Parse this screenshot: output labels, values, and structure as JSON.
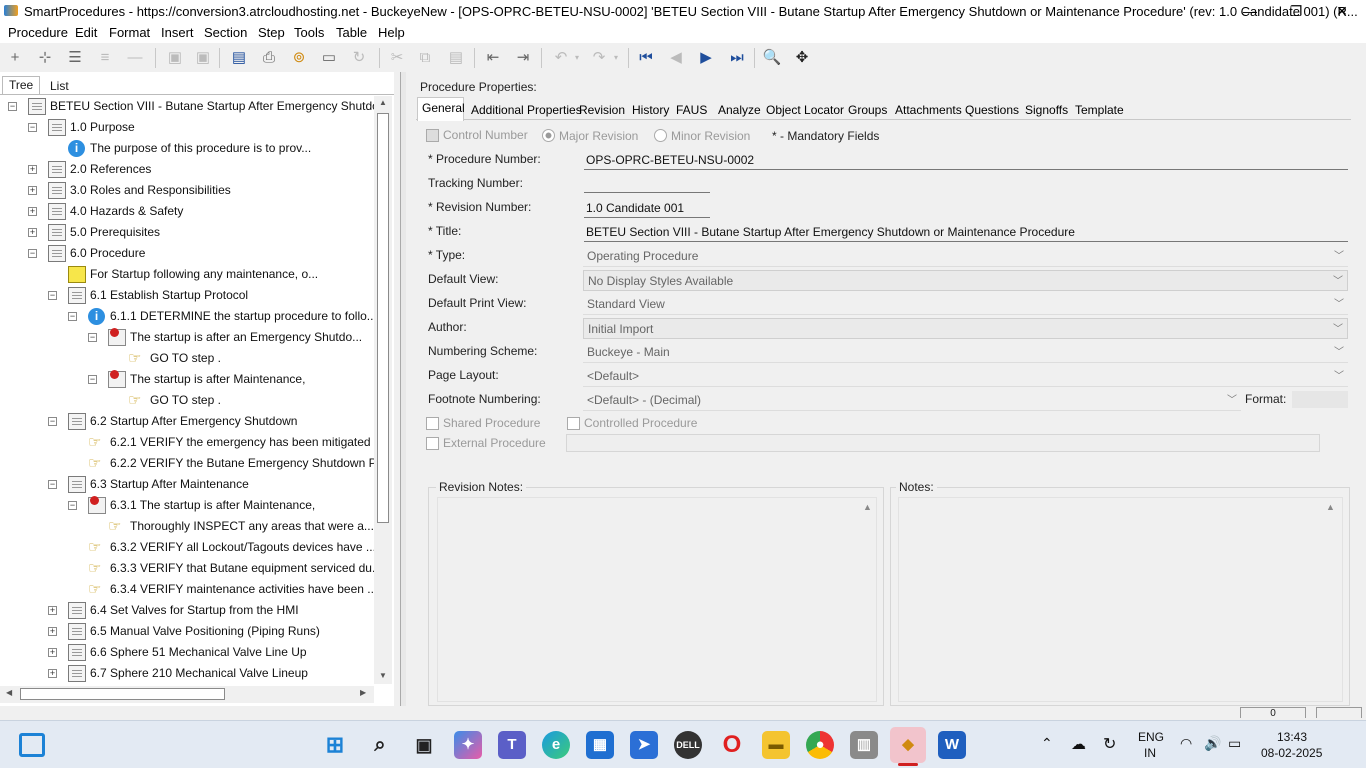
{
  "window": {
    "title": "SmartProcedures - https://conversion3.atrcloudhosting.net - BuckeyeNew - [OPS-OPRC-BETEU-NSU-0002] 'BETEU Section VIII - Butane Startup After Emergency Shutdown or Maintenance Procedure' (rev: 1.0 Candidate 001) (R...",
    "minimize": "—",
    "restore": "❐",
    "close": "✕"
  },
  "menu": [
    "Procedure",
    "Edit",
    "Format",
    "Insert",
    "Section",
    "Step",
    "Tools",
    "Table",
    "Help"
  ],
  "left_tabs": {
    "tree": "Tree",
    "list": "List"
  },
  "tree": [
    {
      "label": "BETEU Section VIII - Butane Startup After Emergency Shutdo...",
      "expander": "⊟",
      "icon": "doc-icon"
    },
    {
      "label": "1.0 Purpose",
      "expander": "⊟",
      "icon": "doc-icon"
    },
    {
      "label": "The purpose of this procedure is to prov...",
      "expander": "",
      "icon": "info-icon"
    },
    {
      "label": "2.0 References",
      "expander": "⊞",
      "icon": "doc-icon"
    },
    {
      "label": "3.0 Roles and Responsibilities",
      "expander": "⊞",
      "icon": "doc-icon"
    },
    {
      "label": "4.0 Hazards & Safety",
      "expander": "⊞",
      "icon": "doc-icon"
    },
    {
      "label": "5.0 Prerequisites",
      "expander": "⊞",
      "icon": "doc-icon"
    },
    {
      "label": "6.0 Procedure",
      "expander": "⊟",
      "icon": "doc-icon"
    },
    {
      "label": "For Startup following any maintenance, o...",
      "expander": "",
      "icon": "warning-icon"
    },
    {
      "label": "6.1 Establish Startup Protocol",
      "expander": "⊟",
      "icon": "doc-icon"
    },
    {
      "label": "6.1.1 DETERMINE the startup procedure to follo...",
      "expander": "⊟",
      "icon": "info-icon"
    },
    {
      "label": "The startup is after an Emergency Shutdo...",
      "expander": "⊟",
      "icon": "condition-icon"
    },
    {
      "label": "GO TO step .",
      "expander": "",
      "icon": "hand-icon"
    },
    {
      "label": "The startup is after Maintenance,",
      "expander": "⊟",
      "icon": "condition-icon"
    },
    {
      "label": "GO TO step .",
      "expander": "",
      "icon": "hand-icon"
    },
    {
      "label": "6.2 Startup After Emergency Shutdown",
      "expander": "⊟",
      "icon": "doc-icon"
    },
    {
      "label": "6.2.1 VERIFY the emergency has been mitigated ...",
      "expander": "",
      "icon": "hand-icon"
    },
    {
      "label": "6.2.2 VERIFY the Butane Emergency Shutdown Pr...",
      "expander": "",
      "icon": "hand-icon"
    },
    {
      "label": "6.3 Startup After Maintenance",
      "expander": "⊟",
      "icon": "doc-icon"
    },
    {
      "label": "6.3.1 The startup is after Maintenance,",
      "expander": "⊟",
      "icon": "condition-icon"
    },
    {
      "label": "Thoroughly INSPECT any areas that were a...",
      "expander": "",
      "icon": "hand-icon"
    },
    {
      "label": "6.3.2 VERIFY all Lockout/Tagouts devices have ...",
      "expander": "",
      "icon": "hand-icon"
    },
    {
      "label": "6.3.3 VERIFY that Butane equipment serviced du...",
      "expander": "",
      "icon": "hand-icon"
    },
    {
      "label": "6.3.4 VERIFY maintenance activities have been ...",
      "expander": "",
      "icon": "hand-icon"
    },
    {
      "label": "6.4 Set Valves for Startup from the HMI",
      "expander": "⊞",
      "icon": "doc-icon"
    },
    {
      "label": "6.5 Manual Valve Positioning (Piping Runs)",
      "expander": "⊞",
      "icon": "doc-icon"
    },
    {
      "label": "6.6 Sphere 51 Mechanical Valve Line Up",
      "expander": "⊞",
      "icon": "doc-icon"
    },
    {
      "label": "6.7 Sphere 210 Mechanical Valve Lineup",
      "expander": "⊞",
      "icon": "doc-icon"
    }
  ],
  "props": {
    "heading": "Procedure Properties:",
    "tabs": [
      "General",
      "Additional Properties",
      "Revision",
      "History",
      "FAUS",
      "Analyze",
      "Object Locator",
      "Groups",
      "Attachments",
      "Questions",
      "Signoffs",
      "Template"
    ],
    "control_number": "Control Number",
    "major_revision": "Major Revision",
    "minor_revision": "Minor Revision",
    "mandatory_note": "* - Mandatory Fields",
    "fields": {
      "procedure_number": {
        "label": "* Procedure Number:",
        "value": "OPS-OPRC-BETEU-NSU-0002"
      },
      "tracking_number": {
        "label": "Tracking Number:",
        "value": ""
      },
      "revision_number": {
        "label": "* Revision Number:",
        "value": "1.0 Candidate 001"
      },
      "title": {
        "label": "* Title:",
        "value": "BETEU Section VIII - Butane Startup After Emergency Shutdown or Maintenance Procedure"
      },
      "type": {
        "label": "* Type:",
        "value": "Operating Procedure"
      },
      "default_view": {
        "label": "Default View:",
        "value": "No Display Styles Available"
      },
      "default_print_view": {
        "label": "Default Print View:",
        "value": "Standard View"
      },
      "author": {
        "label": "Author:",
        "value": "Initial Import"
      },
      "numbering_scheme": {
        "label": "Numbering Scheme:",
        "value": "Buckeye - Main"
      },
      "page_layout": {
        "label": "Page Layout:",
        "value": "<Default>"
      },
      "footnote_numbering": {
        "label": "Footnote Numbering:",
        "value": "<Default> - (Decimal)"
      },
      "format": {
        "label": "Format:",
        "value": ""
      }
    },
    "shared_procedure": "Shared Procedure",
    "controlled_procedure": "Controlled Procedure",
    "external_procedure": "External Procedure",
    "revision_notes": "Revision Notes:",
    "notes": "Notes:"
  },
  "statusbar": {
    "count": "0"
  },
  "taskbar": {
    "lang1": "ENG",
    "lang2": "IN",
    "time": "13:43",
    "date": "08-02-2025"
  }
}
